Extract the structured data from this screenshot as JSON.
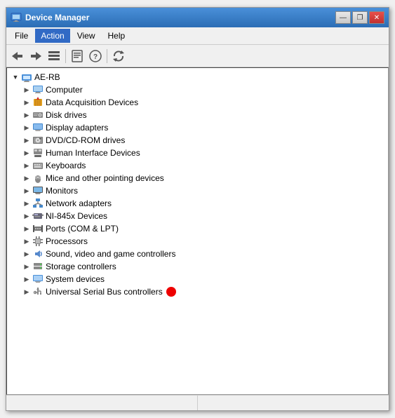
{
  "window": {
    "title": "Device Manager",
    "title_icon": "🖥",
    "buttons": {
      "minimize": "—",
      "restore": "❐",
      "close": "✕"
    }
  },
  "menu": {
    "items": [
      {
        "label": "File",
        "active": false
      },
      {
        "label": "Action",
        "active": true
      },
      {
        "label": "View",
        "active": false
      },
      {
        "label": "Help",
        "active": false
      }
    ]
  },
  "toolbar": {
    "buttons": [
      {
        "name": "back",
        "icon": "←"
      },
      {
        "name": "forward",
        "icon": "→"
      },
      {
        "name": "up",
        "icon": "▤"
      },
      {
        "name": "properties",
        "icon": "🗒"
      },
      {
        "name": "help",
        "icon": "❓"
      },
      {
        "name": "refresh",
        "icon": "🔄"
      }
    ]
  },
  "tree": {
    "root": {
      "label": "AE-RB",
      "icon": "🖥",
      "expanded": true
    },
    "children": [
      {
        "label": "Computer",
        "icon": "💻",
        "selected": true,
        "expand": "▶",
        "has_dot": false
      },
      {
        "label": "Data Acquisition Devices",
        "icon": "✦",
        "selected": false,
        "expand": "▶",
        "has_dot": false
      },
      {
        "label": "Disk drives",
        "icon": "💾",
        "selected": false,
        "expand": "▶",
        "has_dot": false
      },
      {
        "label": "Display adapters",
        "icon": "🖥",
        "selected": false,
        "expand": "▶",
        "has_dot": false
      },
      {
        "label": "DVD/CD-ROM drives",
        "icon": "💿",
        "selected": false,
        "expand": "▶",
        "has_dot": false
      },
      {
        "label": "Human Interface Devices",
        "icon": "⌨",
        "selected": false,
        "expand": "▶",
        "has_dot": false
      },
      {
        "label": "Keyboards",
        "icon": "⌨",
        "selected": false,
        "expand": "▶",
        "has_dot": false
      },
      {
        "label": "Mice and other pointing devices",
        "icon": "🖱",
        "selected": false,
        "expand": "▶",
        "has_dot": false
      },
      {
        "label": "Monitors",
        "icon": "🖥",
        "selected": false,
        "expand": "▶",
        "has_dot": false
      },
      {
        "label": "Network adapters",
        "icon": "🌐",
        "selected": false,
        "expand": "▶",
        "has_dot": false
      },
      {
        "label": "NI-845x Devices",
        "icon": "📟",
        "selected": false,
        "expand": "▶",
        "has_dot": false
      },
      {
        "label": "Ports (COM & LPT)",
        "icon": "🔌",
        "selected": false,
        "expand": "▶",
        "has_dot": false
      },
      {
        "label": "Processors",
        "icon": "⚙",
        "selected": false,
        "expand": "▶",
        "has_dot": false
      },
      {
        "label": "Sound, video and game controllers",
        "icon": "🔊",
        "selected": false,
        "expand": "▶",
        "has_dot": false
      },
      {
        "label": "Storage controllers",
        "icon": "💾",
        "selected": false,
        "expand": "▶",
        "has_dot": false
      },
      {
        "label": "System devices",
        "icon": "🖥",
        "selected": false,
        "expand": "▶",
        "has_dot": false
      },
      {
        "label": "Universal Serial Bus controllers",
        "icon": "🔌",
        "selected": false,
        "expand": "▶",
        "has_dot": true
      }
    ]
  },
  "status": {
    "left": "",
    "right": ""
  },
  "icons": {
    "computer": "💻",
    "device_manager": "🖥"
  }
}
